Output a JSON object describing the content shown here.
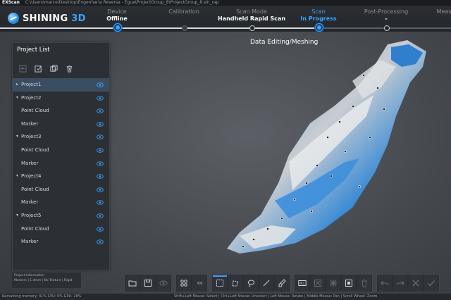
{
  "titlebar": {
    "app": "EXScan",
    "path": "C:\\Users\\marce\\Desktop\\Engenharia Reversa - Égua\\ProjectGroup_8\\ProjectGroup_8.sln_rap"
  },
  "logo": {
    "word1": "SHINING",
    "word2": "3D"
  },
  "steps": [
    {
      "name": "Device",
      "state": "Offline"
    },
    {
      "name": "Calibration",
      "state": ""
    },
    {
      "name": "Scan Mode",
      "state": "Handheld Rapid Scan"
    },
    {
      "name": "Scan",
      "state": "In Progress"
    },
    {
      "name": "Post-Processing",
      "state": "-"
    },
    {
      "name": "Meas",
      "state": ""
    }
  ],
  "subtitle": "Data Editing/Meshing",
  "panel": {
    "title": "Project List",
    "tools": [
      "new-project-icon",
      "import-icon",
      "duplicate-icon",
      "delete-icon"
    ],
    "items": [
      {
        "label": "Project1",
        "level": 0,
        "arrow": "▸",
        "selected": true
      },
      {
        "label": "Project2",
        "level": 0,
        "arrow": "▾"
      },
      {
        "label": "Point Cloud",
        "level": 1
      },
      {
        "label": "Marker",
        "level": 1
      },
      {
        "label": "Project3",
        "level": 0,
        "arrow": "▾"
      },
      {
        "label": "Point Cloud",
        "level": 1
      },
      {
        "label": "Marker",
        "level": 1
      },
      {
        "label": "Project4",
        "level": 0,
        "arrow": "▾"
      },
      {
        "label": "Point Cloud",
        "level": 1
      },
      {
        "label": "Marker",
        "level": 1
      },
      {
        "label": "Project5",
        "level": 0,
        "arrow": "▾"
      },
      {
        "label": "Point Cloud",
        "level": 1
      },
      {
        "label": "Marker",
        "level": 1
      }
    ]
  },
  "info": {
    "title": "Project Information",
    "details": "Markers | 1.4mm | No Texture | Rigid"
  },
  "status": {
    "left": "Remaining memory: 41% CPU: 0% GPU: 28%",
    "right": "Shift+Left Mouse: Select | Ctrl+Left Mouse: Unselect | Left Mouse: Rotate | Middle Mouse: Pan | Scroll Wheel: Zoom"
  },
  "toolbar": {
    "all_label": "ALL"
  },
  "colors": {
    "accent": "#3aa3ff",
    "scan_blue": "#3a8fdc",
    "scan_white": "#e6e8ea"
  }
}
